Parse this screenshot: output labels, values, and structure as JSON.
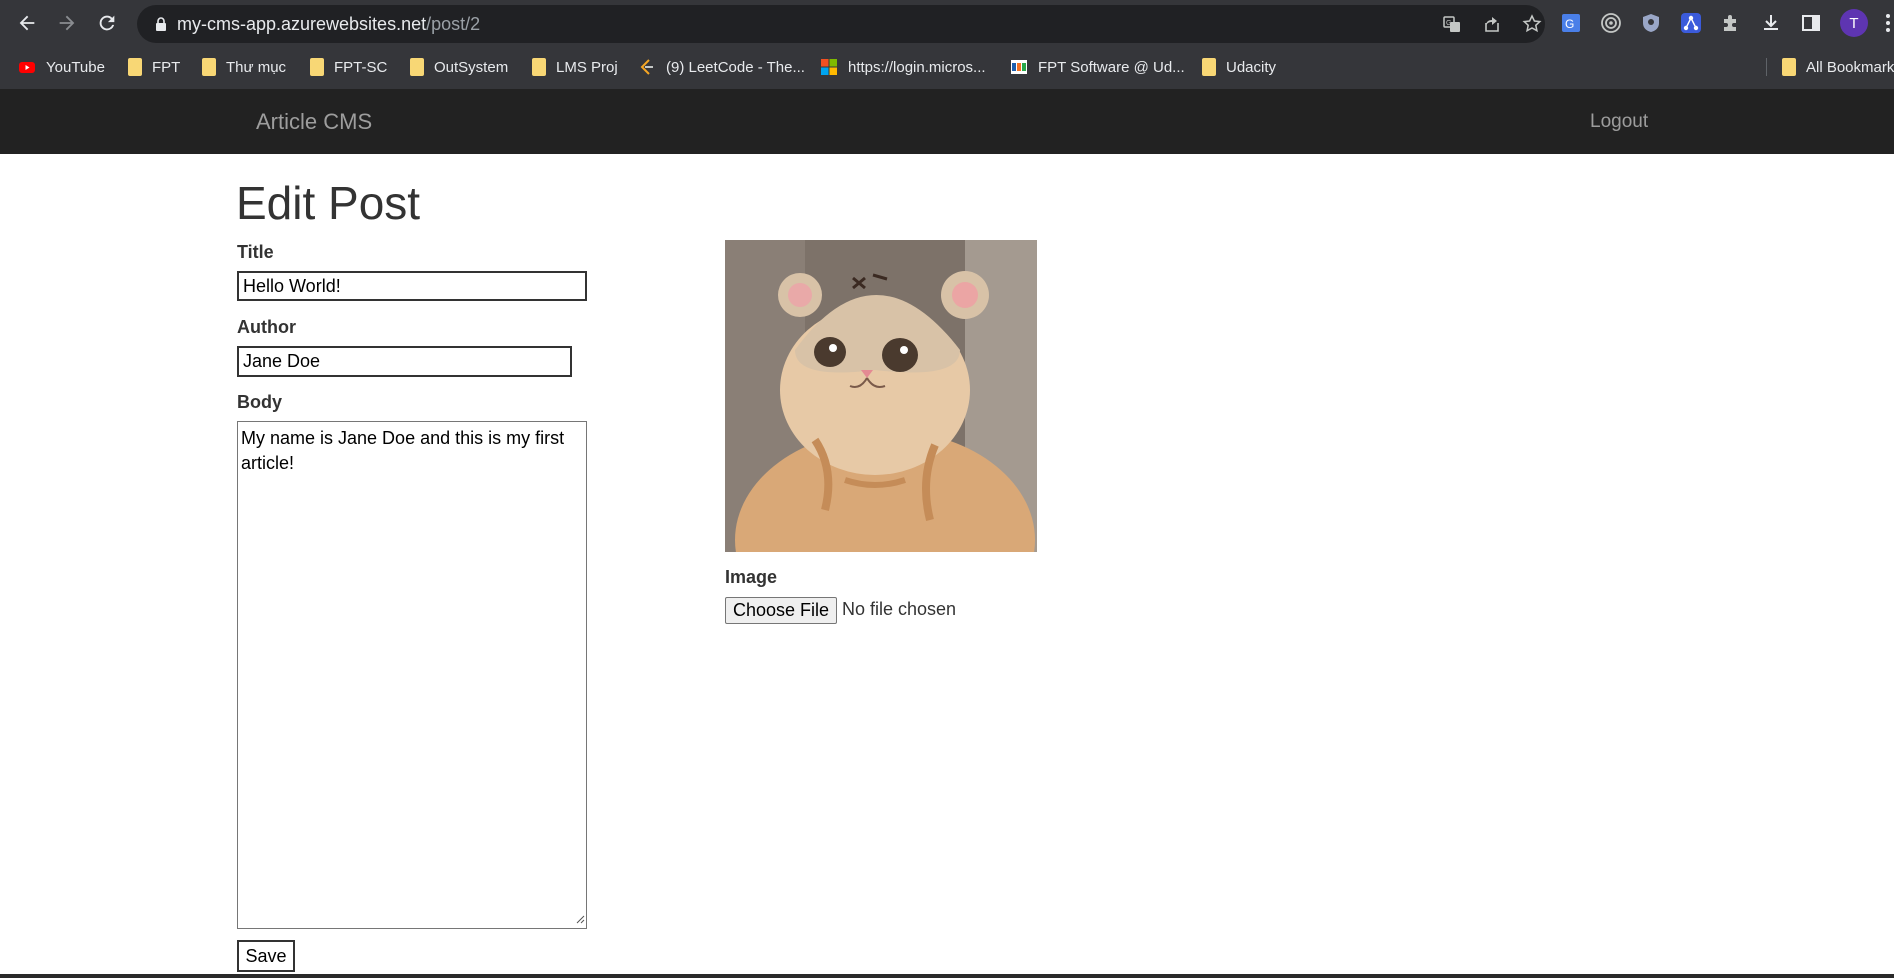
{
  "browser": {
    "url_host": "my-cms-app.azurewebsites.net",
    "url_path": "/post/2",
    "avatar_initial": "T",
    "bookmarks": [
      {
        "label": "YouTube",
        "icon": "youtube-icon"
      },
      {
        "label": "FPT",
        "icon": "folder-icon"
      },
      {
        "label": "Thư mục",
        "icon": "folder-icon"
      },
      {
        "label": "FPT-SC",
        "icon": "folder-icon"
      },
      {
        "label": "OutSystem",
        "icon": "folder-icon"
      },
      {
        "label": "LMS Proj",
        "icon": "folder-icon"
      },
      {
        "label": "(9) LeetCode - The...",
        "icon": "leetcode-icon"
      },
      {
        "label": "https://login.micros...",
        "icon": "microsoft-icon"
      },
      {
        "label": "FPT Software @ Ud...",
        "icon": "fpt-icon"
      },
      {
        "label": "Udacity",
        "icon": "folder-icon"
      }
    ],
    "all_bookmarks": "All Bookmarks"
  },
  "navbar": {
    "brand": "Article CMS",
    "logout": "Logout"
  },
  "form": {
    "heading": "Edit Post",
    "title_label": "Title",
    "title_value": "Hello World!",
    "author_label": "Author",
    "author_value": "Jane Doe",
    "body_label": "Body",
    "body_value": "My name is Jane Doe and this is my first article!",
    "image_label": "Image",
    "choose_file": "Choose File",
    "file_status": "No file chosen",
    "save_label": "Save"
  },
  "colors": {
    "chrome_bg": "#35363a",
    "omnibox_bg": "#202124",
    "navbar_bg": "#222222",
    "navbar_text": "#9d9d9d"
  }
}
